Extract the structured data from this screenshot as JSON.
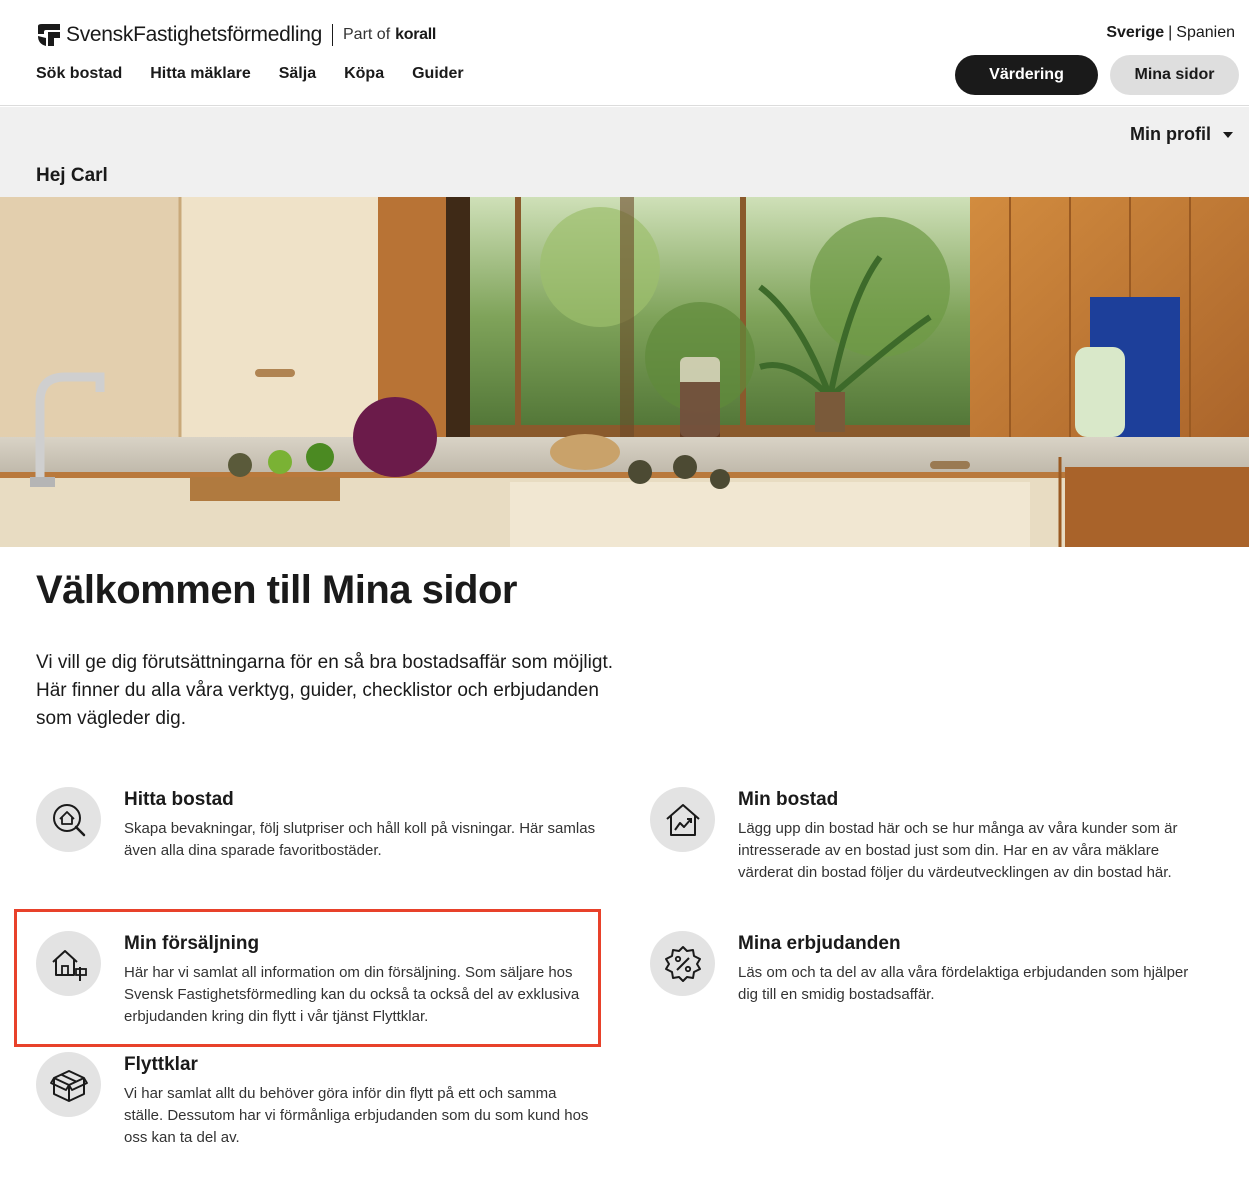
{
  "header": {
    "logo_text": "SvenskFastighetsförmedling",
    "logo_part_of": "Part of",
    "logo_brand": "korall",
    "lang_active": "Sverige",
    "lang_divider": "|",
    "lang_other": "Spanien",
    "nav": [
      "Sök bostad",
      "Hitta mäklare",
      "Sälja",
      "Köpa",
      "Guider"
    ],
    "btn_valuation": "Värdering",
    "btn_mypages": "Mina sidor"
  },
  "profile": {
    "dropdown_label": "Min profil",
    "greeting": "Hej Carl"
  },
  "main": {
    "title": "Välkommen till Mina sidor",
    "intro": "Vi vill ge dig förutsättningarna för en så bra bostadsaffär som möjligt. Här finner du alla våra verktyg, guider, checklistor och erbjudanden som vägleder dig."
  },
  "cards": [
    {
      "title": "Hitta bostad",
      "desc": "Skapa bevakningar, följ slutpriser och håll koll på visningar. Här samlas även alla dina sparade favoritbostäder.",
      "icon": "house-search-icon"
    },
    {
      "title": "Min bostad",
      "desc": "Lägg upp din bostad här och se hur många av våra kunder som är intresserade av en bostad just som din. Har en av våra mäklare värderat din bostad följer du värdeutvecklingen av din bostad här.",
      "icon": "house-chart-icon"
    },
    {
      "title": "Min försäljning",
      "desc": "Här har vi samlat all information om din försäljning. Som säljare hos Svensk Fastighetsförmedling kan du också ta också del av exklusiva erbjudanden kring din flytt i vår tjänst Flyttklar.",
      "icon": "house-sign-icon"
    },
    {
      "title": "Mina erbjudanden",
      "desc": "Läs om och ta del av alla våra fördelaktiga erbjudanden som hjälper dig till en smidig bostadsaffär.",
      "icon": "percent-badge-icon"
    },
    {
      "title": "Flyttklar",
      "desc": "Vi har samlat allt du behöver göra inför din flytt på ett och samma ställe. Dessutom har vi förmånliga erbjudanden som du som kund hos oss kan ta del av.",
      "icon": "box-icon"
    }
  ],
  "colors": {
    "primary_dark": "#1a1a1a",
    "button_light": "#dedede",
    "profile_bar": "#f0f0f0",
    "icon_circle": "#e3e3e3",
    "highlight": "#e8412a"
  }
}
